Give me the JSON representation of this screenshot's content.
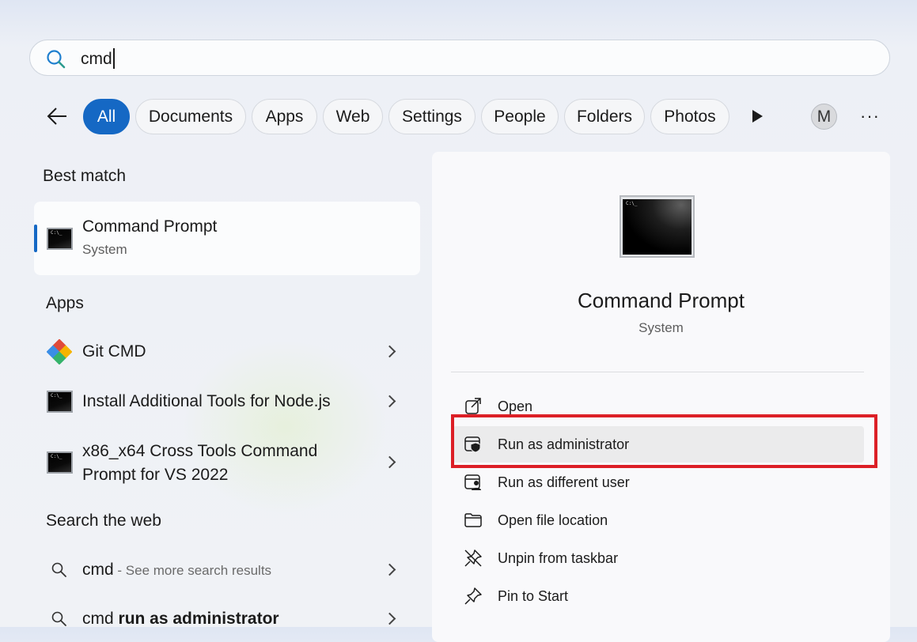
{
  "search": {
    "value": "cmd"
  },
  "filters": [
    "All",
    "Documents",
    "Apps",
    "Web",
    "Settings",
    "People",
    "Folders",
    "Photos"
  ],
  "avatar_letter": "M",
  "more_glyph": "···",
  "left": {
    "best_match": {
      "heading": "Best match",
      "title": "Command Prompt",
      "subtitle": "System"
    },
    "apps": {
      "heading": "Apps",
      "items": [
        {
          "title": "Git CMD"
        },
        {
          "title": "Install Additional Tools for Node.js"
        },
        {
          "title_line1": "x86_x64 Cross Tools Command",
          "title_line2": "Prompt for VS 2022"
        }
      ]
    },
    "web": {
      "heading": "Search the web",
      "items": [
        {
          "query": "cmd",
          "suffix": " - See more search results"
        },
        {
          "query": "cmd ",
          "bold": "run as administrator"
        }
      ]
    }
  },
  "panel": {
    "title": "Command Prompt",
    "subtitle": "System",
    "actions": [
      "Open",
      "Run as administrator",
      "Run as different user",
      "Open file location",
      "Unpin from taskbar",
      "Pin to Start"
    ]
  },
  "colors": {
    "accent": "#1568c4",
    "highlight_box": "#dc1f26"
  },
  "icons": [
    "search-icon",
    "back-arrow-icon",
    "play-icon",
    "command-prompt-icon",
    "git-icon",
    "chevron-right-icon",
    "open-external-icon",
    "shield-icon",
    "user-icon",
    "folder-icon",
    "unpin-icon",
    "pin-icon"
  ]
}
